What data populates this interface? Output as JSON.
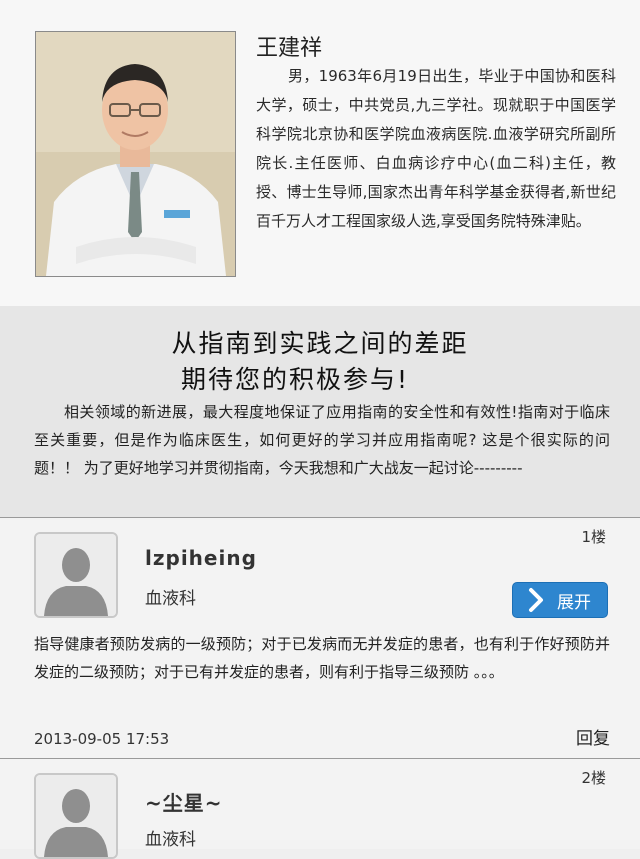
{
  "doctor": {
    "name": "王建祥",
    "bio": "男，1963年6月19日出生，毕业于中国协和医科大学，硕士，中共党员,九三学社。现就职于中国医学科学院北京协和医学院血液病医院.血液学研究所副所院长.主任医师、白血病诊疗中心(血二科)主任，教授、博士生导师,国家杰出青年科学基金获得者,新世纪百千万人才工程国家级人选,享受国务院特殊津贴。"
  },
  "topic": {
    "title_line1": "从指南到实践之间的差距",
    "title_line2": "期待您的积极参与!",
    "body": "相关领域的新进展，最大程度地保证了应用指南的安全性和有效性!指南对于临床至关重要，但是作为临床医生，如何更好的学习并应用指南呢? 这是个很实际的问题！！ 为了更好地学习并贯彻指南，今天我想和广大战友一起讨论---------"
  },
  "replies": [
    {
      "floor": "1楼",
      "username": "lzpiheing",
      "department": "血液科",
      "expand_label": "展开",
      "text": "指导健康者预防发病的一级预防；对于已发病而无并发症的患者，也有利于作好预防并发症的二级预防；对于已有并发症的患者，则有利于指导三级预防 。。。",
      "time": "2013-09-05  17:53",
      "reply_label": "回复"
    },
    {
      "floor": "2楼",
      "username": "~尘星~",
      "department": "血液科"
    }
  ],
  "colors": {
    "accent": "#2e86cf",
    "topic_bg": "#e6e6e6",
    "profile_bg": "#f7f7f7"
  },
  "icons": {
    "avatar": "user-silhouette-icon",
    "expand": "chevron-right-icon"
  }
}
